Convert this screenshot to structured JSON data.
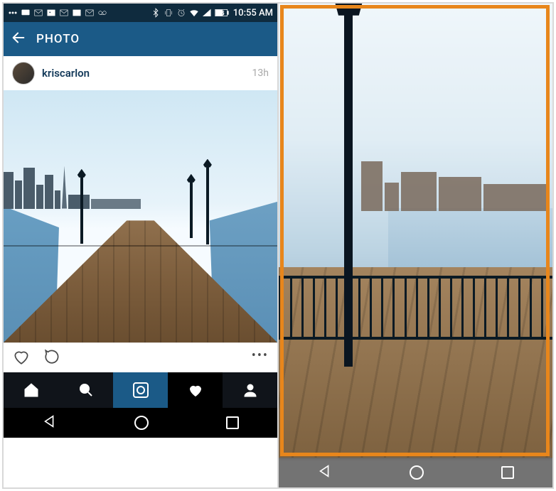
{
  "left": {
    "statusbar": {
      "time": "10:55 AM",
      "icons_left": [
        "more",
        "msg",
        "mail",
        "photo",
        "mail2",
        "photo2",
        "mail3",
        "voicemail"
      ],
      "icons_right": [
        "bt",
        "vibrate",
        "alarm",
        "wifi",
        "signal",
        "battery"
      ],
      "battery_text": "55"
    },
    "header": {
      "title": "PHOTO"
    },
    "post": {
      "username": "kriscarlon",
      "time": "13h"
    },
    "tabs": [
      "home",
      "search",
      "camera",
      "activity",
      "profile"
    ]
  },
  "right": {
    "highlight_color": "#e8861b"
  }
}
